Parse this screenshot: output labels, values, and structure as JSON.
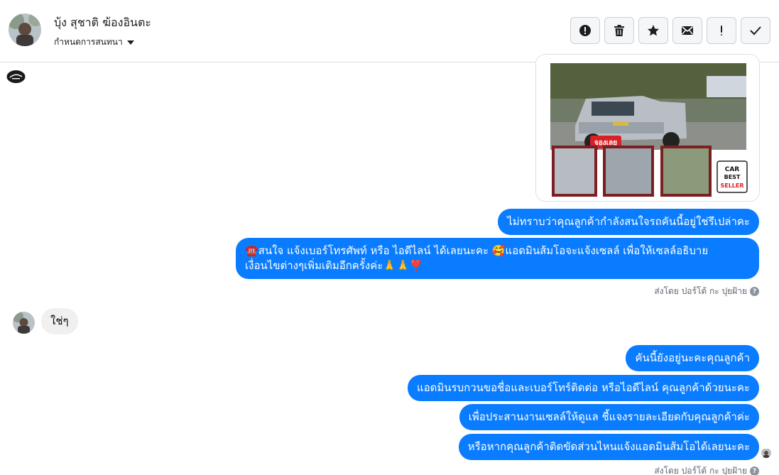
{
  "header": {
    "contact_name": "บุ้ง สุชาติ ฆ้องอินตะ",
    "nickname_label": "กำหนดการสนทนา"
  },
  "toolbar": {
    "buttons": [
      {
        "icon": "alert-circle-icon"
      },
      {
        "icon": "trash-icon"
      },
      {
        "icon": "star-icon"
      },
      {
        "icon": "envelope-icon"
      },
      {
        "icon": "exclamation-icon"
      },
      {
        "icon": "check-icon"
      }
    ]
  },
  "image_card": {
    "badge_text": "จองเลย",
    "seller_badge": [
      "CAR",
      "BEST",
      "SELLER"
    ]
  },
  "messages": {
    "out_1": "ไม่ทราบว่าคุณลูกค้ากำลังสนใจรถคันนี้อยู่ใช่รึเปล่าคะ",
    "out_2_line1": "☎️สนใจ แจ้งเบอร์โทรศัพท์ หรือ ไอดีไลน์  ได้เลยนะคะ 🥰แอดมินส้มโอจะแจ้งเซลล์     เพื่อให้เซลล์อธิบาย",
    "out_2_line2": "เงื่อนไขต่างๆเพิ่มเติมอีกครั้งค่ะ🙏🙏❣️",
    "sent_by_1": "ส่งโดย ปอร์โต้ กะ ปุยฝ้าย",
    "in_1": "ใช่ๆ",
    "out_3": "คันนี้ยังอยู่นะคะคุณลูกค้า",
    "out_4": "แอดมินรบกวนขอชื่อและเบอร์โทร์ติดต่อ หรือไอดีไลน์ คุณลูกค้าด้วยนะคะ",
    "out_5": "เพื่อประสานงานเซลล์ให้ดูแล ชี้แจงรายละเอียดกับคุณลูกค้าค่ะ",
    "out_6": "หรือหากคุณลูกค้าติดขัดส่วนไหนแจ้งแอดมินส้มโอได้เลยนะคะ",
    "sent_by_2": "ส่งโดย ปอร์โต้ กะ ปุยฝ้าย"
  },
  "colors": {
    "outgoing_bubble": "#0a7cff",
    "incoming_bubble": "#f0f0f0"
  }
}
